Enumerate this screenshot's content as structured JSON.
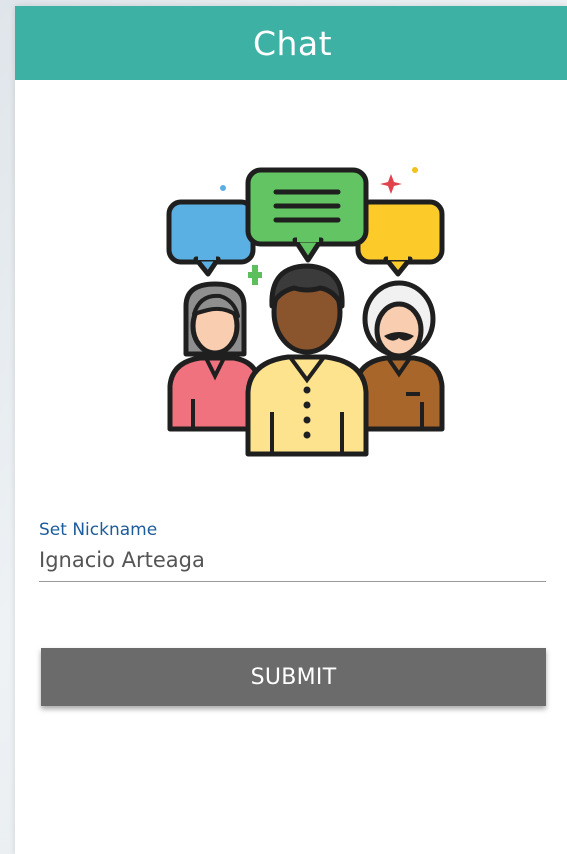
{
  "header": {
    "title": "Chat",
    "background": "#3eb1a5"
  },
  "illustration": {
    "icon": "group-chat-icon"
  },
  "nickname": {
    "label": "Set Nickname",
    "value": "Ignacio Arteaga",
    "label_color": "#1d5b9a"
  },
  "submit": {
    "label": "SUBMIT",
    "background": "#6b6b6b"
  }
}
